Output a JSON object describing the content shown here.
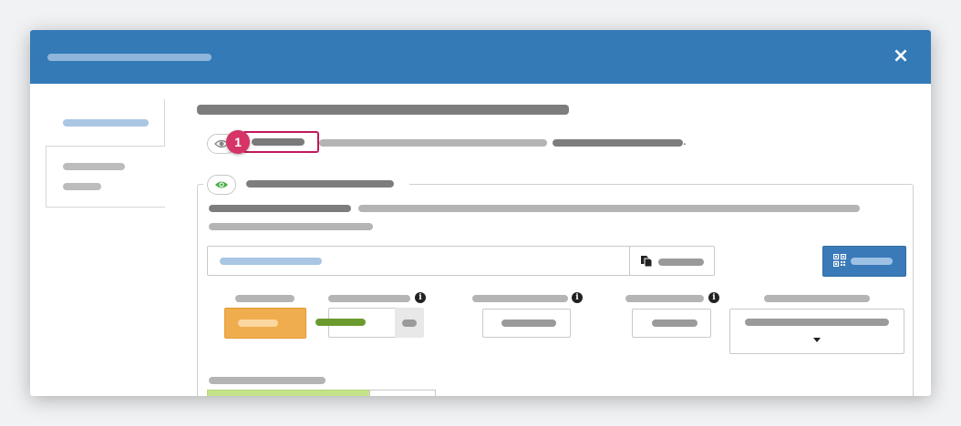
{
  "modal": {
    "close_glyph": "×",
    "step_badge": "1",
    "trailing_period": "."
  },
  "colors": {
    "header": "#337ab7",
    "badge": "#d63366",
    "primary_button": "#3a7ab9",
    "warning_button": "#f0ad4e",
    "success_text": "#6b9a2f",
    "success_fill": "#c5e48a",
    "eye_active": "#4cae4c"
  }
}
